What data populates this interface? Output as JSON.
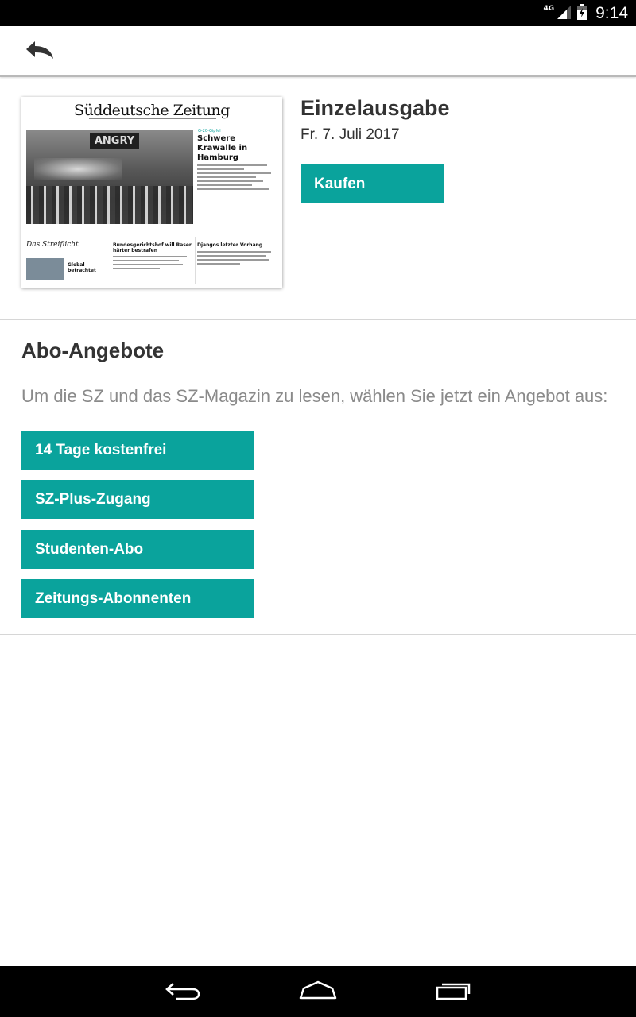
{
  "status_bar": {
    "network": "4G",
    "time": "9:14",
    "icons": [
      "signal-icon",
      "battery-icon"
    ]
  },
  "app_bar": {
    "back_icon": "back-arrow-icon"
  },
  "single_issue": {
    "title": "Einzelausgabe",
    "date": "Fr. 7. Juli 2017",
    "buy_label": "Kaufen",
    "cover": {
      "masthead": "Süddeutsche Zeitung",
      "photo_sign": "ANGRY",
      "kicker": "G-20-Gipfel",
      "headline": "Schwere Krawalle in Hamburg",
      "streiflicht": "Das Streiflicht",
      "col1_head": "Bundesgerichtshof will Raser härter bestrafen",
      "col2_head": "Djangos letzter Vorhang",
      "video_head": "Global betrachtet"
    }
  },
  "offers": {
    "title": "Abo-Angebote",
    "description": "Um die SZ und das SZ-Magazin zu lesen, wählen Sie jetzt ein Angebot aus:",
    "items": [
      {
        "label": "14 Tage kostenfrei"
      },
      {
        "label": "SZ-Plus-Zugang"
      },
      {
        "label": "Studenten-Abo"
      },
      {
        "label": "Zeitungs-Abonnenten"
      }
    ]
  },
  "nav_bar": {
    "icons": [
      "back-nav-icon",
      "home-nav-icon",
      "recents-nav-icon"
    ]
  },
  "colors": {
    "accent": "#0aa39c",
    "text": "#333333",
    "muted": "#8a8a8a"
  }
}
